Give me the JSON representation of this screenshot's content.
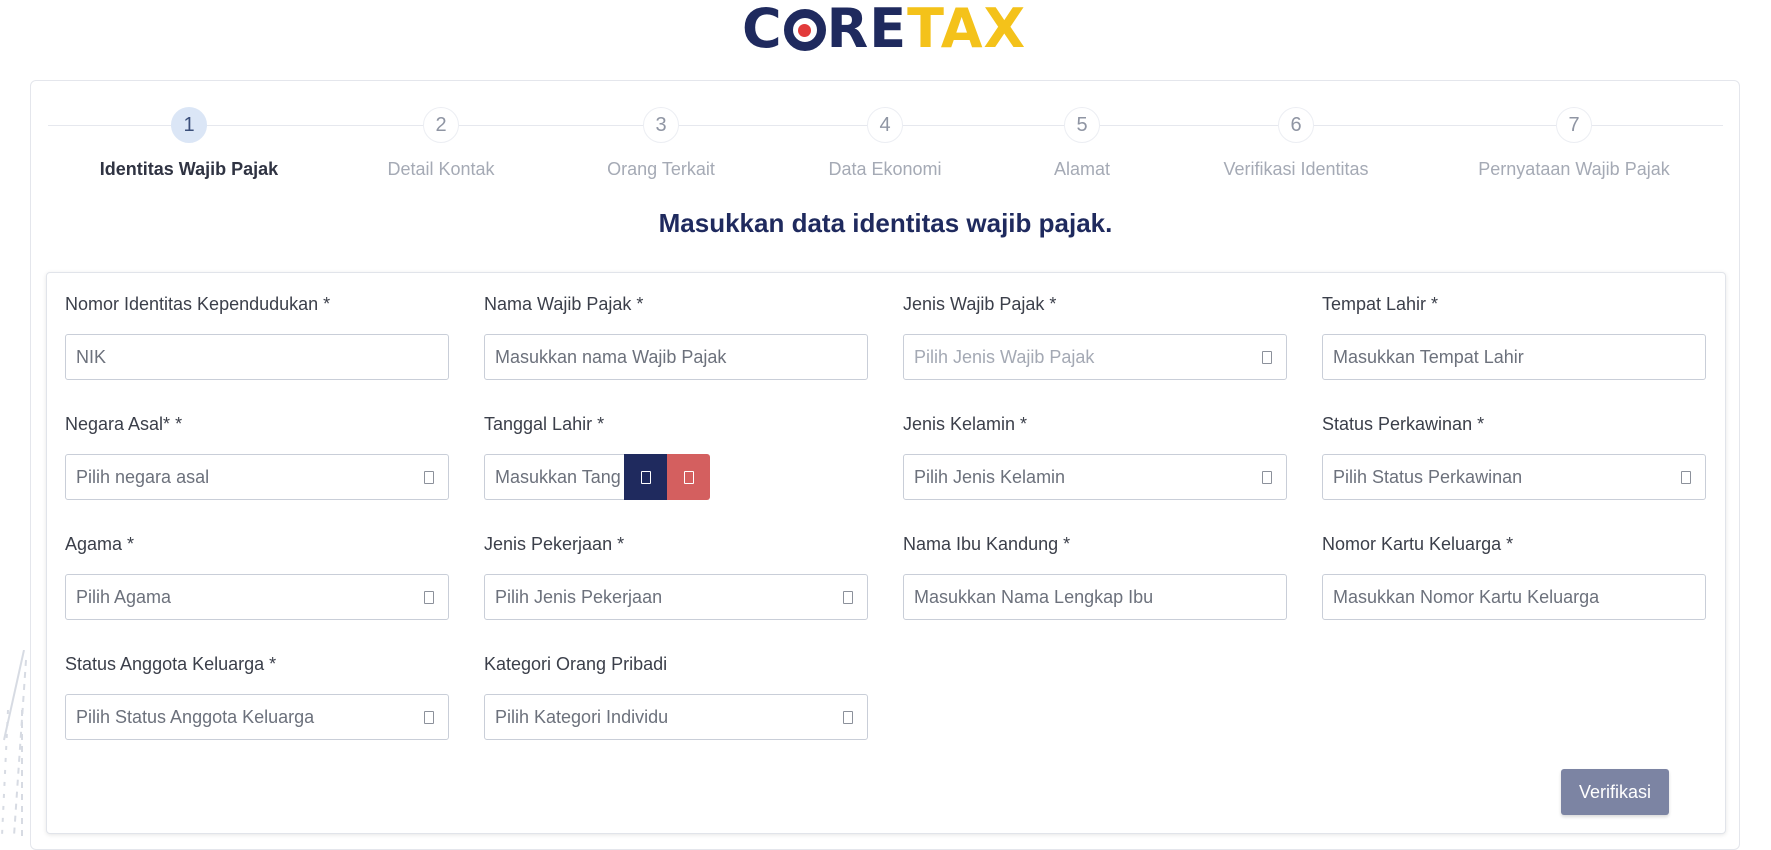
{
  "brand": {
    "part1": "C",
    "part2": "RE",
    "part3": "TAX"
  },
  "steps": [
    {
      "num": "1",
      "label": "Identitas Wajib Pajak",
      "active": true
    },
    {
      "num": "2",
      "label": "Detail Kontak"
    },
    {
      "num": "3",
      "label": "Orang Terkait"
    },
    {
      "num": "4",
      "label": "Data Ekonomi"
    },
    {
      "num": "5",
      "label": "Alamat"
    },
    {
      "num": "6",
      "label": "Verifikasi Identitas"
    },
    {
      "num": "7",
      "label": "Pernyataan Wajib Pajak"
    }
  ],
  "heading": "Masukkan data identitas wajib pajak.",
  "fields": {
    "nik": {
      "label": "Nomor Identitas Kependudukan *",
      "placeholder": "NIK"
    },
    "nama": {
      "label": "Nama Wajib Pajak *",
      "placeholder": "Masukkan nama Wajib Pajak"
    },
    "jenis_wp": {
      "label": "Jenis Wajib Pajak *",
      "placeholder": "Pilih Jenis Wajib Pajak"
    },
    "tempat_lahir": {
      "label": "Tempat Lahir *",
      "placeholder": "Masukkan Tempat Lahir"
    },
    "negara": {
      "label": "Negara Asal* *",
      "placeholder": "Pilih negara asal"
    },
    "tanggal_lahir": {
      "label": "Tanggal Lahir *",
      "placeholder": "Masukkan Tang"
    },
    "jenis_kelamin": {
      "label": "Jenis Kelamin *",
      "placeholder": "Pilih Jenis Kelamin"
    },
    "status_kawin": {
      "label": "Status Perkawinan *",
      "placeholder": "Pilih Status Perkawinan"
    },
    "agama": {
      "label": "Agama *",
      "placeholder": "Pilih Agama"
    },
    "pekerjaan": {
      "label": "Jenis Pekerjaan *",
      "placeholder": "Pilih Jenis Pekerjaan"
    },
    "ibu": {
      "label": "Nama Ibu Kandung *",
      "placeholder": "Masukkan Nama Lengkap Ibu"
    },
    "kk": {
      "label": "Nomor Kartu Keluarga *",
      "placeholder": "Masukkan Nomor Kartu Keluarga"
    },
    "status_keluarga": {
      "label": "Status Anggota Keluarga *",
      "placeholder": "Pilih Status Anggota Keluarga"
    },
    "kategori": {
      "label": "Kategori Orang Pribadi",
      "placeholder": "Pilih Kategori Individu"
    }
  },
  "verify_label": "Verifikasi"
}
